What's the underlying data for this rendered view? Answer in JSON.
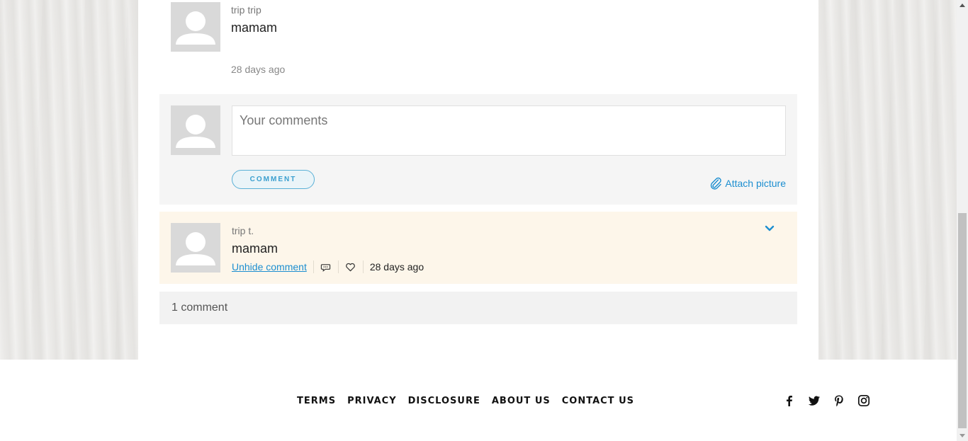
{
  "previous_comment": {
    "author": "trip trip",
    "text": "mamam",
    "time": "28 days ago"
  },
  "compose": {
    "placeholder": "Your comments",
    "comment_button": "COMMENT",
    "attach_label": "Attach picture"
  },
  "hidden_comment": {
    "author": "trip t.",
    "text": "mamam",
    "unhide_label": "Unhide comment",
    "time": "28 days ago"
  },
  "comment_count": "1 comment",
  "footer": {
    "links": [
      "TERMS",
      "PRIVACY",
      "DISCLOSURE",
      "ABOUT US",
      "CONTACT US"
    ],
    "social_icons": [
      "facebook-icon",
      "twitter-icon",
      "pinterest-icon",
      "instagram-icon"
    ]
  },
  "colors": {
    "accent": "#1c8ed0",
    "hidden_comment_bg": "#fdf6ea",
    "compose_bg": "#f5f5f5"
  }
}
